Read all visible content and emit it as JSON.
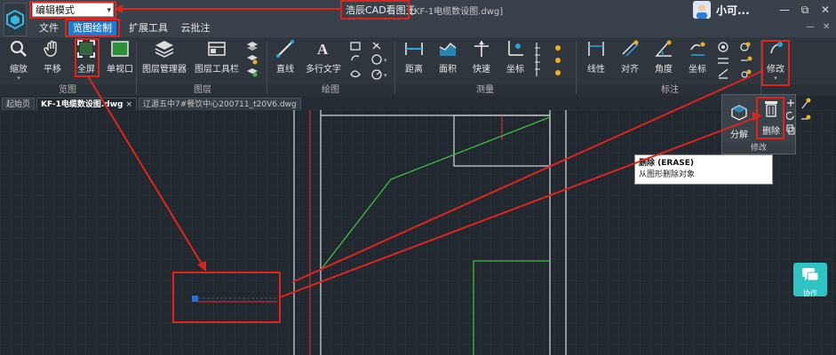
{
  "titlebar": {
    "mode": "编辑模式",
    "app_name": "浩辰CAD看图王",
    "file_title": "[KF-1电缆数设图.dwg]",
    "user_name": "小可...",
    "minimize": "—",
    "restore": "⧉",
    "close": "✕"
  },
  "menubar": {
    "items": [
      "文件",
      "览图绘制",
      "扩展工具",
      "云批注"
    ],
    "active_index": 1,
    "right_minimize": "—",
    "right_close": "✕"
  },
  "ribbon": {
    "groups": [
      {
        "label": "览图",
        "tools": [
          "缩放",
          "平移",
          "全屏",
          "单视口"
        ]
      },
      {
        "label": "图层",
        "tools": [
          "图层管理器",
          "图层工具栏"
        ]
      },
      {
        "label": "绘图",
        "tools": [
          "直线",
          "多行文字"
        ]
      },
      {
        "label": "测量",
        "tools": [
          "距离",
          "面积",
          "快速",
          "坐标"
        ]
      },
      {
        "label": "标注",
        "tools": [
          "线性",
          "对齐",
          "角度",
          "坐标"
        ]
      },
      {
        "label": "修改",
        "tools": [
          "修改"
        ]
      }
    ],
    "accent": "#1f7bd1"
  },
  "tabs": [
    {
      "label": "起始页"
    },
    {
      "label": "KF-1电缆数设图.dwg",
      "close": "×"
    },
    {
      "label": "辽源五中7#餐饮中心200711_t20V6.dwg"
    }
  ],
  "modify_panel": {
    "tools": [
      "分解",
      "删除"
    ],
    "footer": "修改"
  },
  "tooltip": {
    "title": "删除 (ERASE)",
    "description": "从图形删除对象"
  },
  "collab_button": {
    "label": "协作"
  },
  "colors": {
    "annotation_red": "#e0241b",
    "canvas_bg": "#212830",
    "cad_green": "#3fbf3f",
    "cad_white": "#e8e8e8"
  }
}
